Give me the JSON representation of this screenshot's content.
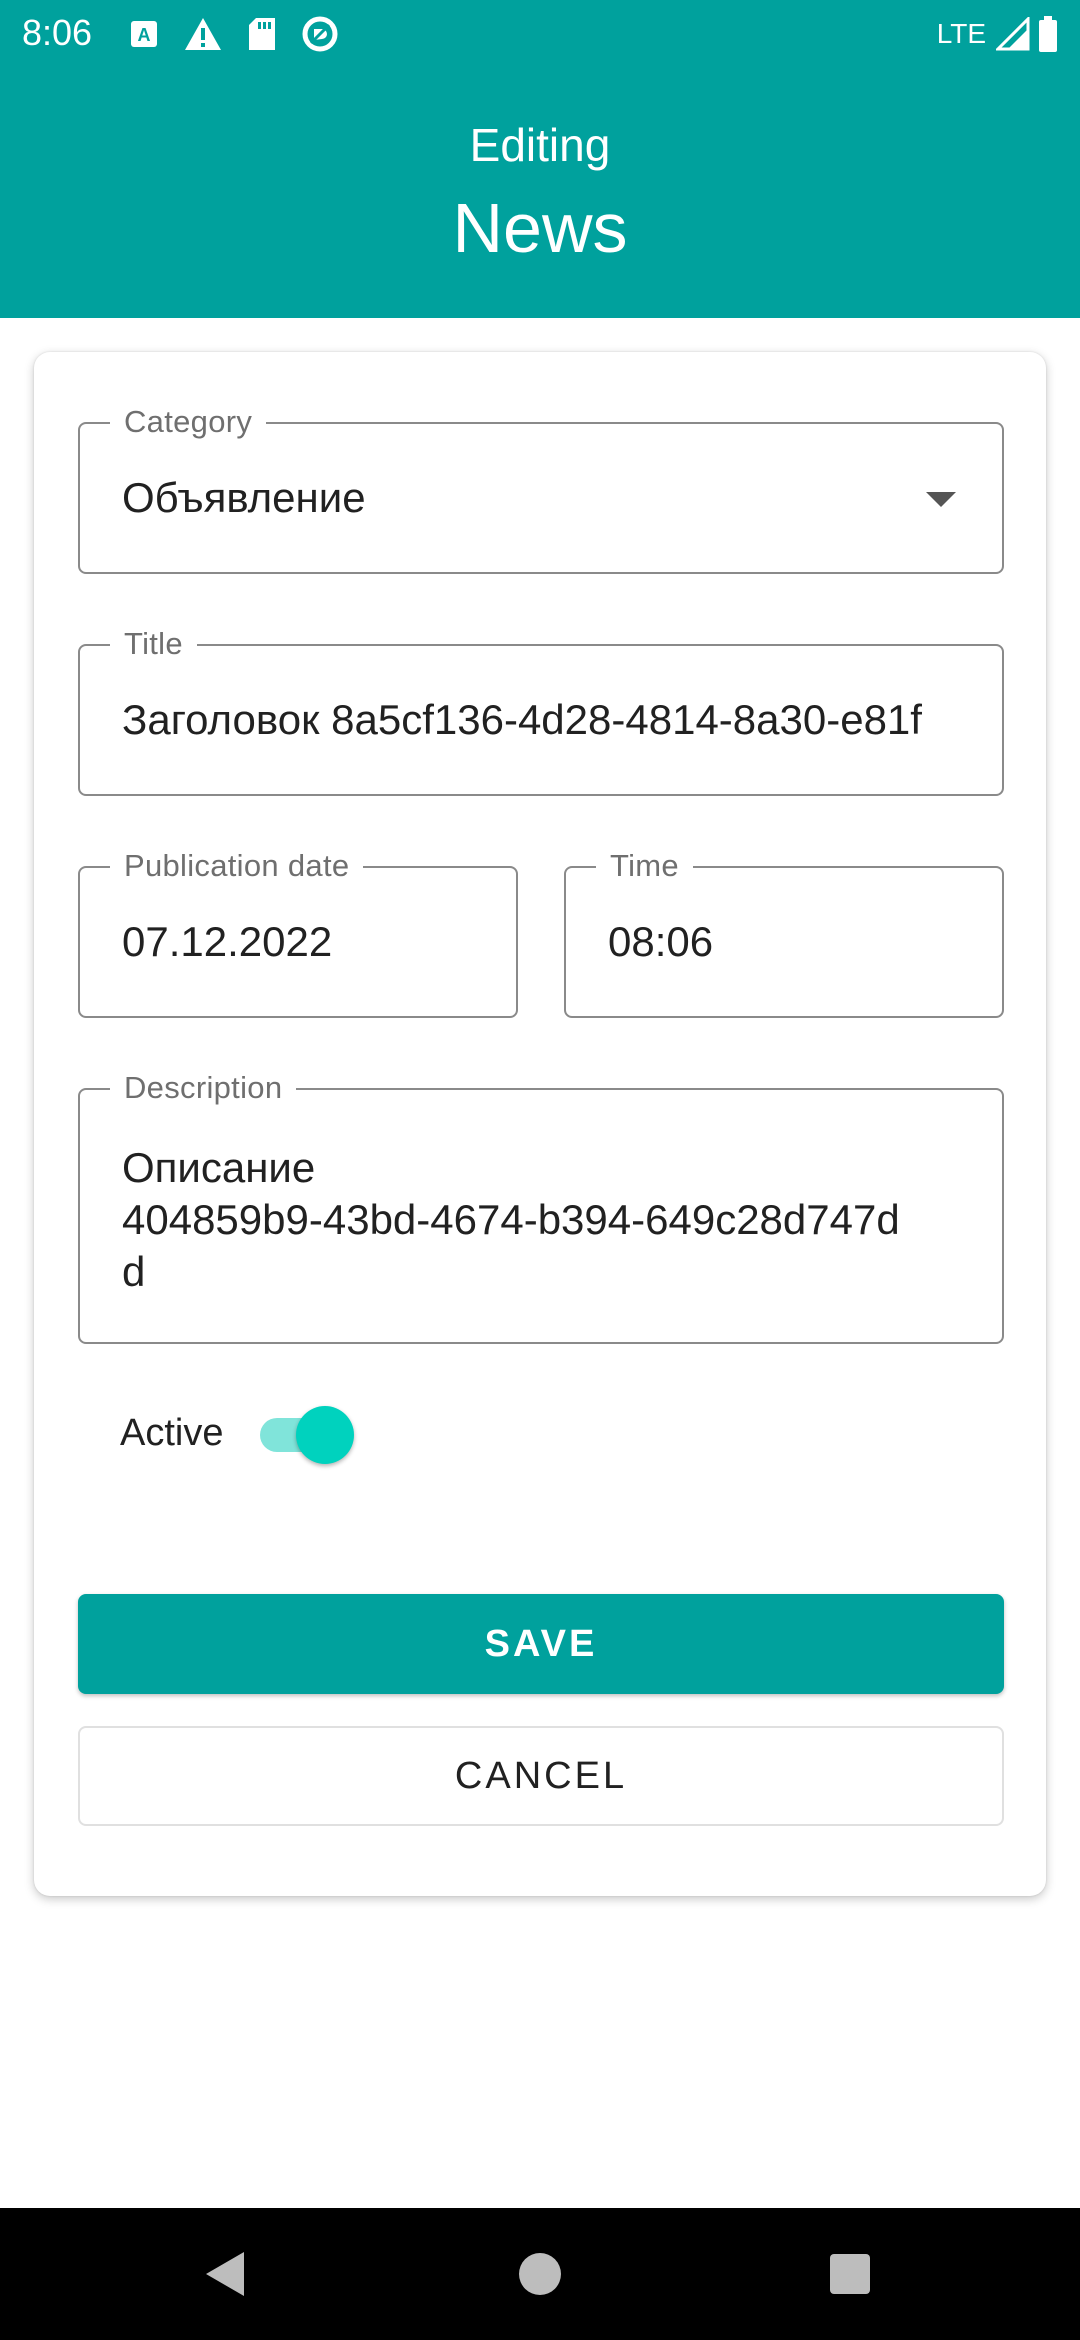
{
  "status_bar": {
    "time": "8:06",
    "network": "LTE",
    "left_icons": [
      "a-keyboard-icon",
      "warning-icon",
      "sd-card-icon",
      "no-disturb-icon"
    ],
    "right_icons": [
      "signal-icon",
      "battery-icon"
    ]
  },
  "header": {
    "subtitle": "Editing",
    "title": "News",
    "background": "#00A19D"
  },
  "form": {
    "category": {
      "label": "Category",
      "value": "Объявление",
      "icon": "dropdown-arrow-icon"
    },
    "title": {
      "label": "Title",
      "value": "Заголовок 8a5cf136-4d28-4814-8a30-e81f"
    },
    "publication_date": {
      "label": "Publication date",
      "value": "07.12.2022"
    },
    "time": {
      "label": "Time",
      "value": "08:06"
    },
    "description": {
      "label": "Description",
      "value": "Описание\n404859b9-43bd-4674-b394-649c28d747d\nd"
    },
    "active": {
      "label": "Active",
      "checked": true,
      "accent": "#00D2BE"
    }
  },
  "buttons": {
    "save": "SAVE",
    "cancel": "CANCEL"
  },
  "nav_bar": {
    "icons": [
      "back-icon",
      "home-icon",
      "recent-apps-icon"
    ]
  }
}
